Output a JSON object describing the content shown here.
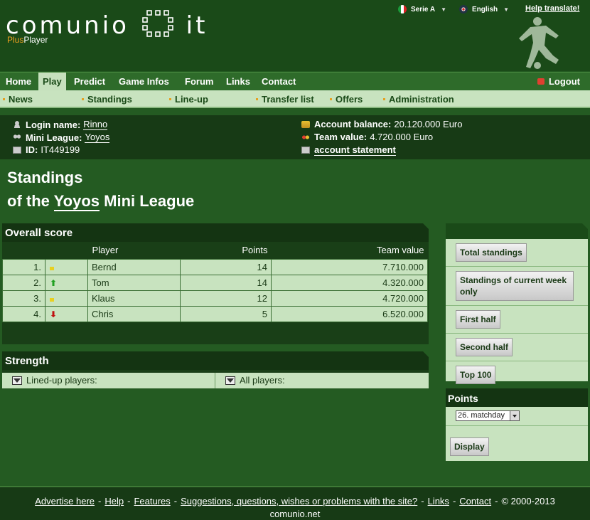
{
  "header": {
    "logo_text": "COMUNIO",
    "logo_suffix": "IT",
    "plus": "Plus",
    "player": "Player",
    "league_select": "Serie A",
    "language_select": "English",
    "help_translate": "Help translate!"
  },
  "mainnav": {
    "items": [
      "Home",
      "Play",
      "Predict",
      "Game Infos",
      "Forum",
      "Links",
      "Contact"
    ],
    "active": "Play",
    "logout": "Logout"
  },
  "subnav": {
    "items": [
      "News",
      "Standings",
      "Line-up",
      "Transfer list",
      "Offers",
      "Administration"
    ]
  },
  "account": {
    "login_label": "Login name:",
    "login_value": "Rinno",
    "league_label": "Mini League:",
    "league_value": "Yoyos",
    "id_label": "ID:",
    "id_value": "IT449199",
    "balance_label": "Account balance:",
    "balance_value": "20.120.000 Euro",
    "team_value_label": "Team value:",
    "team_value_value": "4.720.000 Euro",
    "statement_link": "account statement"
  },
  "title": {
    "line1": "Standings",
    "line2_prefix": "of the",
    "league": "Yoyos",
    "line2_suffix": "Mini League"
  },
  "overall": {
    "heading": "Overall score",
    "columns": [
      "Player",
      "Points",
      "Team value"
    ],
    "rows": [
      {
        "rank": "1.",
        "trend": "same",
        "player": "Bernd",
        "points": "14",
        "value": "7.710.000"
      },
      {
        "rank": "2.",
        "trend": "up",
        "player": "Tom",
        "points": "14",
        "value": "4.320.000"
      },
      {
        "rank": "3.",
        "trend": "same",
        "player": "Klaus",
        "points": "12",
        "value": "4.720.000"
      },
      {
        "rank": "4.",
        "trend": "down",
        "player": "Chris",
        "points": "5",
        "value": "6.520.000"
      }
    ]
  },
  "strength": {
    "heading": "Strength",
    "lined_up": "Lined-up players:",
    "all": "All players:"
  },
  "sidebar": {
    "buttons": [
      "Total standings",
      "Standings of current week only",
      "First half",
      "Second half",
      "Top 100"
    ]
  },
  "points": {
    "heading": "Points",
    "matchday_selected": "26. matchday",
    "display": "Display"
  },
  "footer": {
    "advertise": "Advertise here",
    "help": "Help",
    "features": "Features",
    "suggestions": "Suggestions, questions, wishes or problems with the site?",
    "links": "Links",
    "contact": "Contact",
    "copyright": "© 2000-2013",
    "site": "comunio.net"
  }
}
